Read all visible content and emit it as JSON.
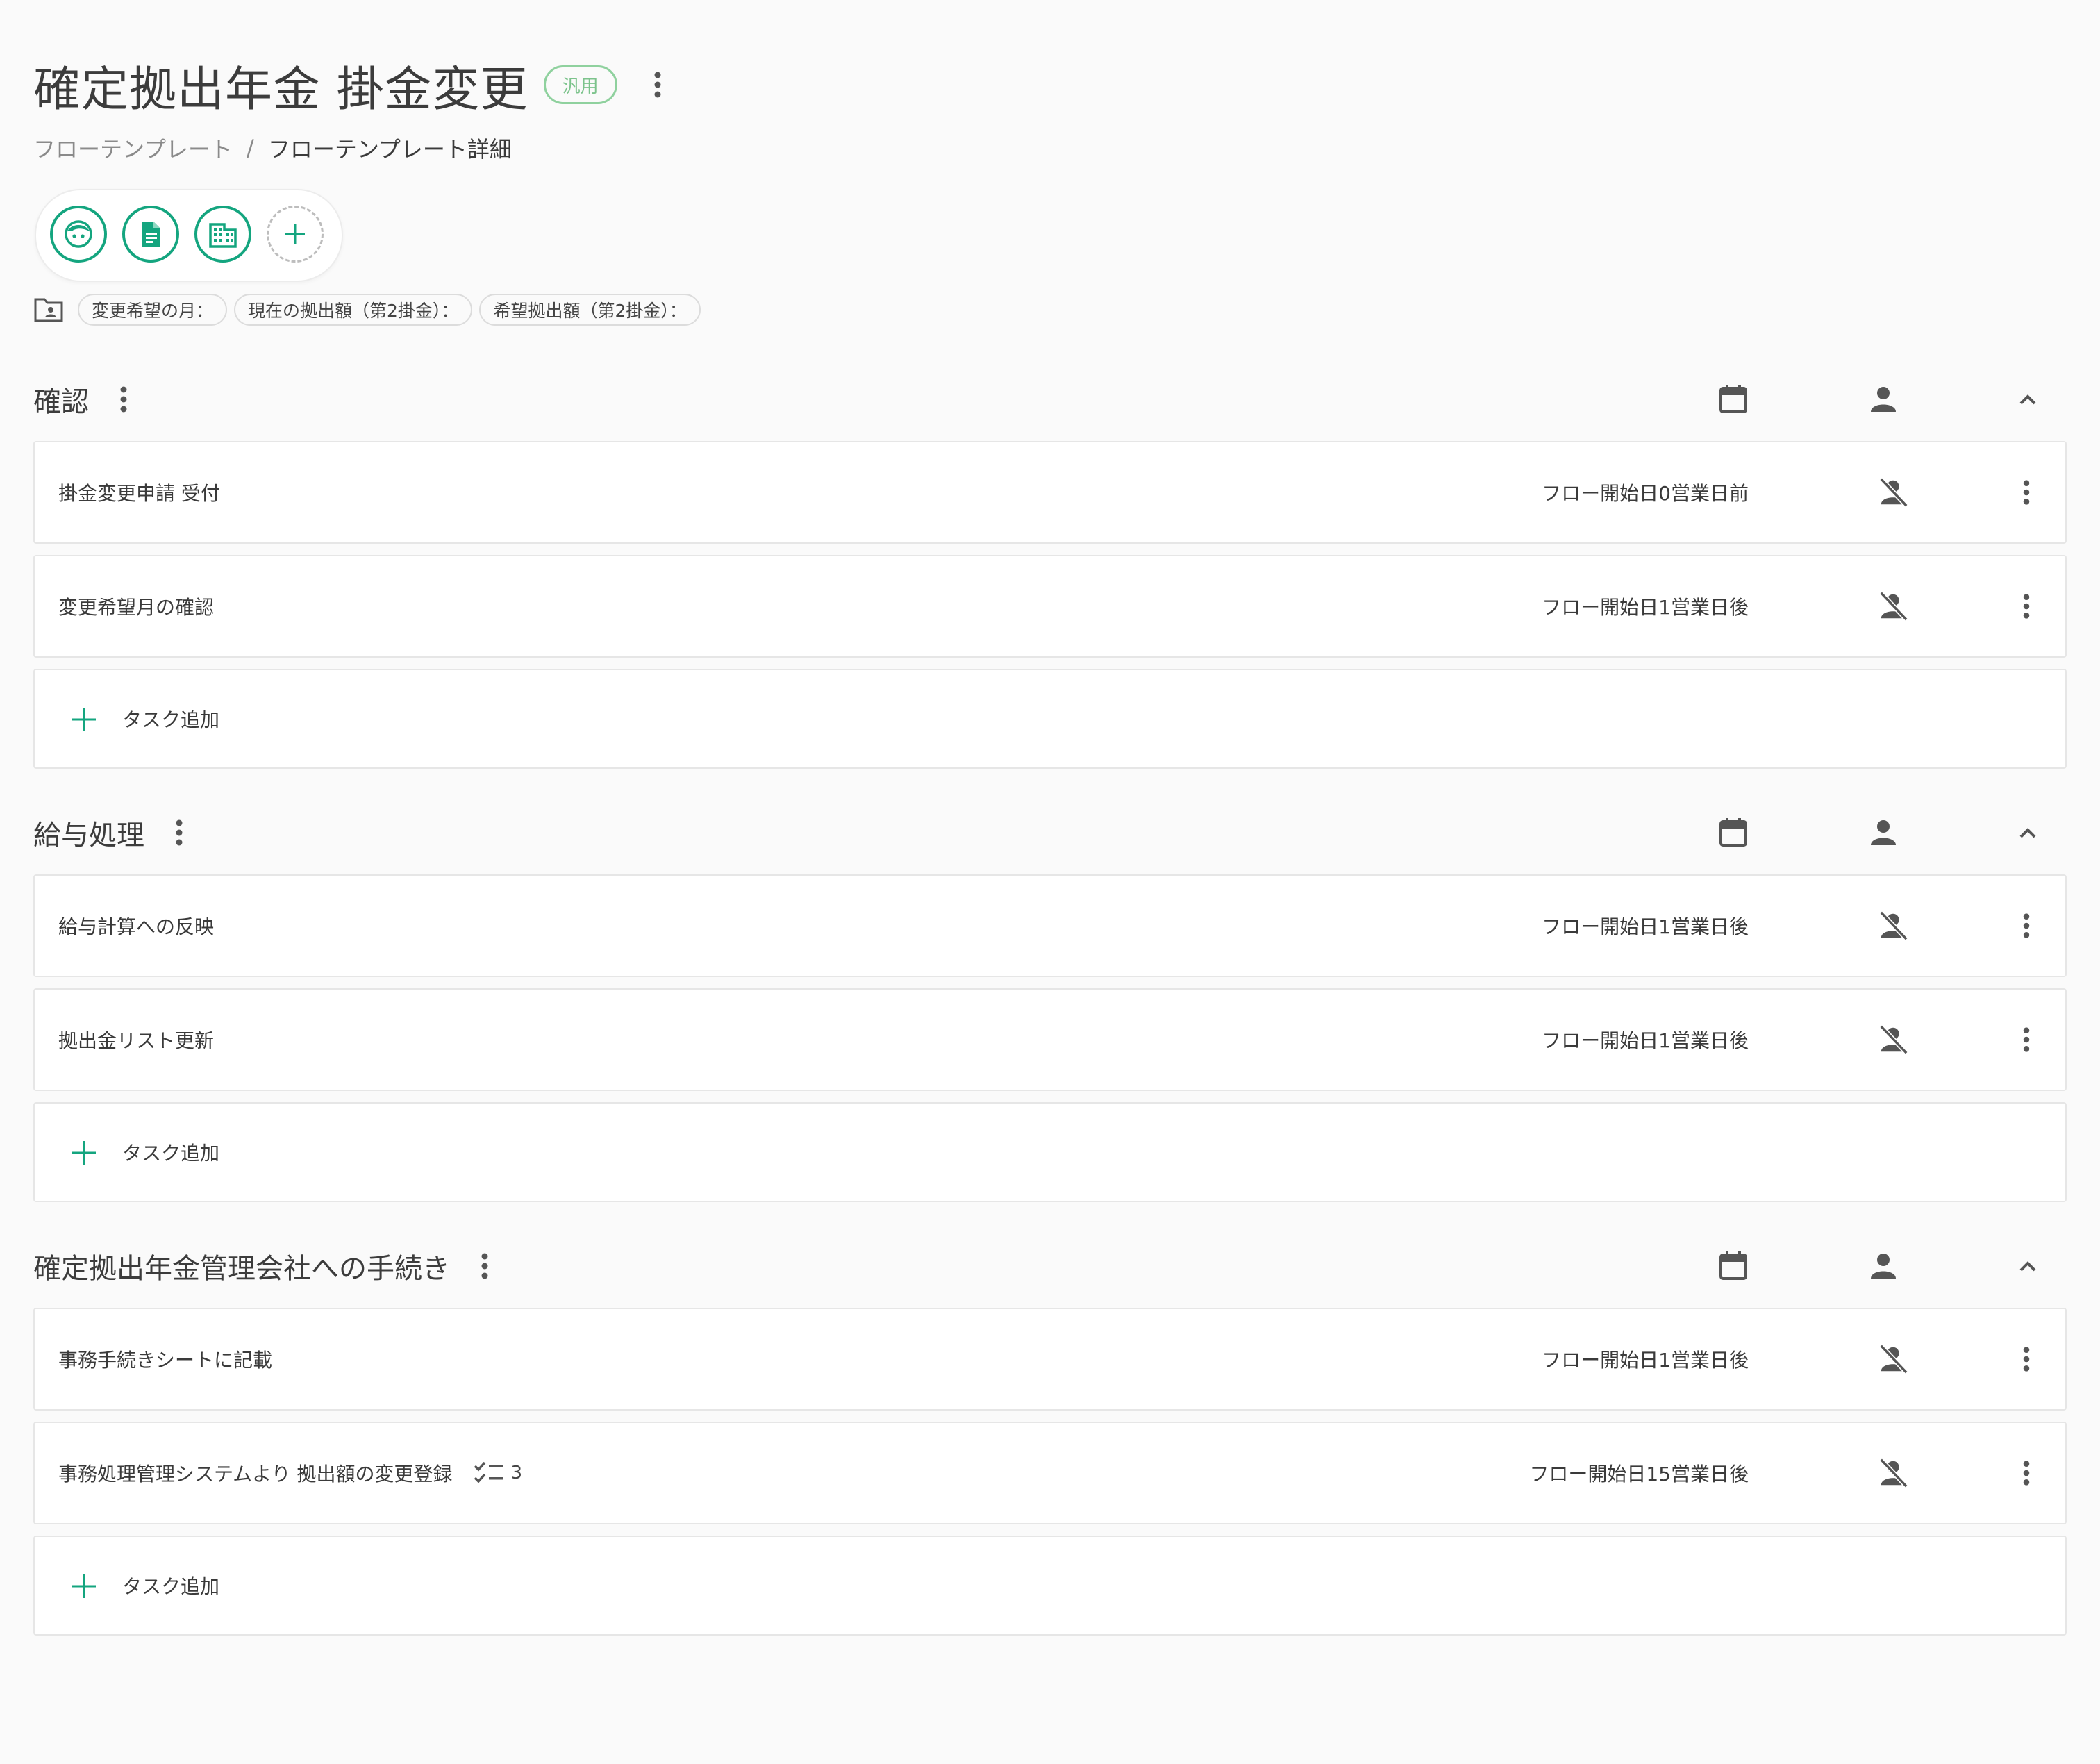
{
  "header": {
    "title": "確定拠出年金 掛金変更",
    "badge": "汎用"
  },
  "breadcrumb": {
    "parent": "フローテンプレート",
    "separator": "/",
    "current": "フローテンプレート詳細"
  },
  "avatars": [
    {
      "icon": "face-icon"
    },
    {
      "icon": "document-icon"
    },
    {
      "icon": "building-icon"
    },
    {
      "icon": "add-icon"
    }
  ],
  "fields": {
    "icon": "folder-account-icon",
    "chips": [
      "変更希望の月：",
      "現在の拠出額（第2掛金）：",
      "希望拠出額（第2掛金）："
    ]
  },
  "add_task_label": "タスク追加",
  "sections": [
    {
      "title": "確認",
      "tasks": [
        {
          "name": "掛金変更申請 受付",
          "date": "フロー開始日0営業日前"
        },
        {
          "name": "変更希望月の確認",
          "date": "フロー開始日1営業日後"
        }
      ]
    },
    {
      "title": "給与処理",
      "tasks": [
        {
          "name": "給与計算への反映",
          "date": "フロー開始日1営業日後"
        },
        {
          "name": "拠出金リスト更新",
          "date": "フロー開始日1営業日後"
        }
      ]
    },
    {
      "title": "確定拠出年金管理会社への手続き",
      "tasks": [
        {
          "name": "事務手続きシートに記載",
          "date": "フロー開始日1営業日後"
        },
        {
          "name": "事務処理管理システムより 拠出額の変更登録",
          "date": "フロー開始日15営業日後",
          "checklist_count": "3"
        }
      ]
    }
  ],
  "colors": {
    "accent": "#14a57f",
    "badge": "#8fd19e",
    "background": "#fafafa",
    "icon": "#555555"
  }
}
